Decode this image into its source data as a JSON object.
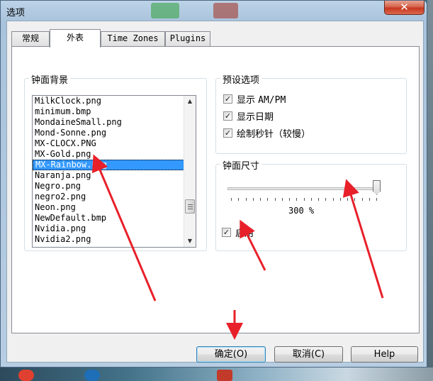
{
  "window": {
    "title": "选项",
    "close_glyph": "✕"
  },
  "tabs": [
    {
      "label": "常规",
      "active": false
    },
    {
      "label": "外表",
      "active": true
    },
    {
      "label": "Time Zones",
      "active": false
    },
    {
      "label": "Plugins",
      "active": false
    }
  ],
  "background_group": {
    "title": "钟面背景",
    "items": [
      "MilkClock.png",
      "minimum.bmp",
      "MondaineSmall.png",
      "Mond-Sonne.png",
      "MX-CLOCX.PNG",
      "MX-Gold.png",
      "MX-Rainbow.png",
      "Naranja.png",
      "Negro.png",
      "negro2.png",
      "Neon.png",
      "NewDefault.bmp",
      "Nvidia.png",
      "Nvidia2.png"
    ],
    "selected": "MX-Rainbow.png"
  },
  "preset_group": {
    "title": "预设选项",
    "options": [
      {
        "label_prefix": "显示 ",
        "label_mono": "AM/PM",
        "label_suffix": "",
        "checked": true
      },
      {
        "label_prefix": "显示日期",
        "label_mono": "",
        "label_suffix": "",
        "checked": true
      },
      {
        "label_prefix": "绘制秒针（较慢）",
        "label_mono": "",
        "label_suffix": "",
        "checked": true
      }
    ]
  },
  "size_group": {
    "title": "钟面尺寸",
    "value_text": "300 %",
    "slider_fraction": 1.0,
    "enable_label": "启用",
    "enable_checked": true
  },
  "buttons": {
    "ok": "确定(O)",
    "cancel": "取消(C)",
    "help": "Help"
  },
  "check_glyph": "✓",
  "colors": {
    "selection": "#3399ff",
    "annotation_arrow": "#e8202a"
  }
}
